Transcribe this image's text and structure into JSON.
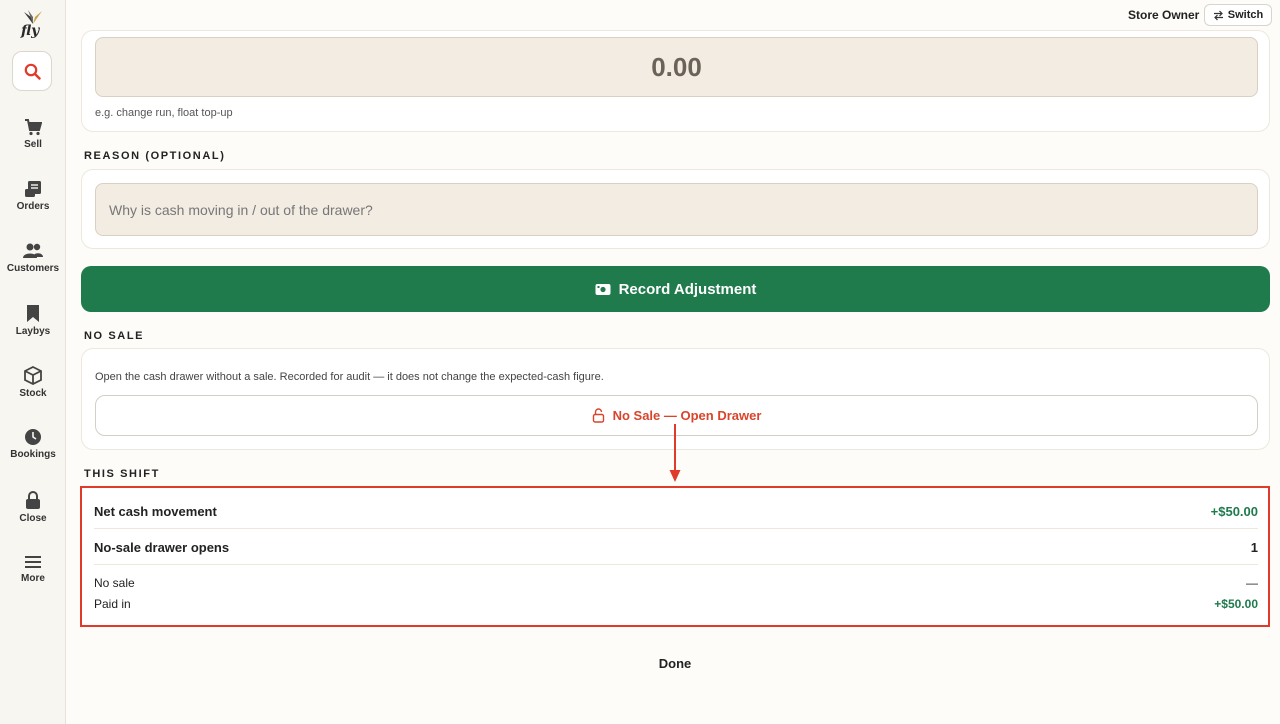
{
  "app": {
    "logo_text": "fly"
  },
  "sidebar": {
    "items": [
      {
        "label": "Sell",
        "icon": "cart-icon"
      },
      {
        "label": "Orders",
        "icon": "receipt-icon"
      },
      {
        "label": "Customers",
        "icon": "people-icon"
      },
      {
        "label": "Laybys",
        "icon": "bookmark-icon"
      },
      {
        "label": "Stock",
        "icon": "box-icon"
      },
      {
        "label": "Bookings",
        "icon": "clock-icon"
      },
      {
        "label": "Close",
        "icon": "lock-icon"
      },
      {
        "label": "More",
        "icon": "menu-icon"
      }
    ]
  },
  "topbar": {
    "user": "Store Owner",
    "switch_label": "Switch"
  },
  "amount": {
    "value": "0.00",
    "hint": "e.g. change run, float top-up"
  },
  "reason": {
    "label": "REASON (OPTIONAL)",
    "placeholder": "Why is cash moving in / out of the drawer?"
  },
  "record_button": {
    "label": "Record Adjustment"
  },
  "no_sale": {
    "label": "NO SALE",
    "description": "Open the cash drawer without a sale. Recorded for audit — it does not change the expected-cash figure.",
    "button_label": "No Sale — Open Drawer"
  },
  "this_shift": {
    "label": "THIS SHIFT",
    "net_cash_label": "Net cash movement",
    "net_cash_value": "+$50.00",
    "no_sale_opens_label": "No-sale drawer opens",
    "no_sale_opens_value": "1",
    "entries": [
      {
        "label": "No sale",
        "value": "—"
      },
      {
        "label": "Paid in",
        "value": "+$50.00"
      }
    ]
  },
  "done_label": "Done",
  "colors": {
    "accent_green": "#1f7a4c",
    "alert_red": "#d9442c",
    "highlight_red": "#e03a2a"
  }
}
